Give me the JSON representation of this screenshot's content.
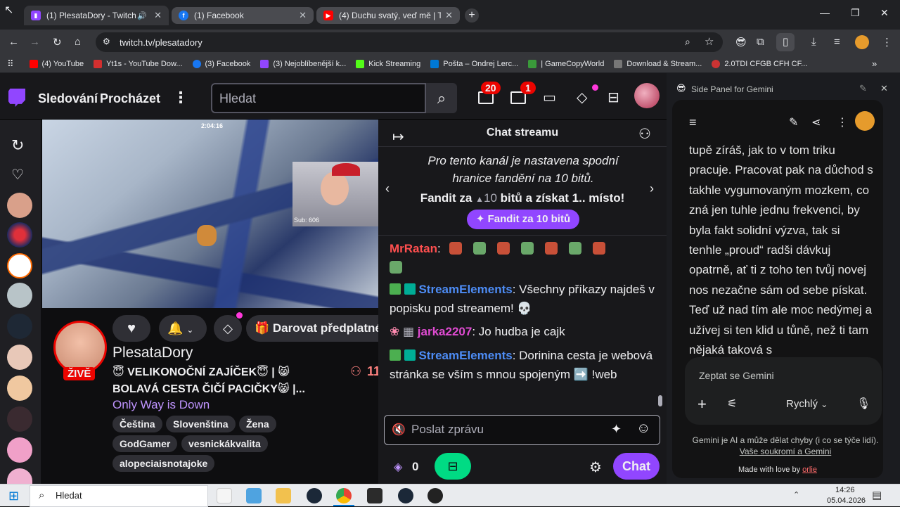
{
  "browser": {
    "tabs": [
      {
        "title": "(1) PlesataDory - Twitch",
        "active": true
      },
      {
        "title": "(1) Facebook",
        "active": false
      },
      {
        "title": "(4) Duchu svatý, veď mě | Temp",
        "active": false
      }
    ],
    "url": "twitch.tv/plesatadory",
    "bookmarks": [
      {
        "label": "(4) YouTube",
        "color": "#ff0000"
      },
      {
        "label": "Yt1s - YouTube Dow...",
        "color": "#d32f2f"
      },
      {
        "label": "(3) Facebook",
        "color": "#1877f2"
      },
      {
        "label": "(3) Nejoblíbenější k...",
        "color": "#9146ff"
      },
      {
        "label": "Kick Streaming",
        "color": "#53fc18"
      },
      {
        "label": "Pošta – Ondrej Lerc...",
        "color": "#0078d4"
      },
      {
        "label": "| GameCopyWorld",
        "color": "#3a9a3a"
      },
      {
        "label": "Download & Stream...",
        "color": "#777777"
      },
      {
        "label": "2.0TDI CFGB CFH CF...",
        "color": "#cc3333"
      }
    ]
  },
  "twitch": {
    "nav": {
      "following": "Sledování",
      "browse": "Procházet",
      "search_placeholder": "Hledat"
    },
    "badges": {
      "inbox": "20",
      "whispers": "1"
    },
    "stream": {
      "timer": "2:04:16",
      "viewer_overlay": "Sub: 606",
      "actions": {
        "gift": "Darovat předplatné"
      },
      "channel": "PlesataDory",
      "live_badge": "ŽIVĚ",
      "title": "😇 VELIKONOČNÍ ZAJÍČEK😇 | 😸 BOLAVÁ CESTA ČIČÍ PACIČKY😸 |...",
      "category": "Only Way is Down",
      "viewers": "11",
      "tags": [
        "Čeština",
        "Slovenština",
        "Žena",
        "GodGamer",
        "vesnickákvalita",
        "alopeciaisnotajoke"
      ]
    },
    "chat": {
      "header": "Chat streamu",
      "notice": "Pro tento kanál je nastavena spodní hranice fandění na 10 bitů.",
      "cheer_prefix": "Fandit za",
      "cheer_bits": "10",
      "cheer_suffix": "bitů a získat 1.. místo!",
      "cheer_button": "Fandit za 10 bitů",
      "messages": [
        {
          "user": "MrRatan",
          "color": "#ff4f4f",
          "text": ""
        },
        {
          "user": "StreamElements",
          "color": "#4d8cf5",
          "text": "Všechny příkazy najdeš v popisku pod streamem! 💀"
        },
        {
          "user": "jarka2207",
          "color": "#e04bd2",
          "text": "Jo hudba je cajk"
        },
        {
          "user": "StreamElements",
          "color": "#4d8cf5",
          "text": "Dorinina cesta je webová stránka se vším s mnou spojeným ➡️ !web"
        }
      ],
      "input_placeholder": "Poslat zprávu",
      "points": "0",
      "send_label": "Chat"
    }
  },
  "gemini": {
    "panel_title": "Side Panel for Gemini",
    "response": "tupě zíráš, jak to v tom triku pracuje. Pracovat pak na důchod s takhle vygumovaným mozkem, co zná jen tuhle jednu frekvenci, by byla fakt solidní výzva, tak si tenhle „proud“ radši dávkuj opatrně, ať ti z toho ten tvůj novej nos nezačne sám od sebe pískat. Teď už nad tím ale moc nedýmej a užívej si ten klid u tůně, než ti tam nějaká taková s",
    "input_placeholder": "Zeptat se Gemini",
    "mode": "Rychlý",
    "disclaimer": "Gemini je AI a může dělat chyby (i co se týče lidí).",
    "privacy_link": "Vaše soukromí a Gemini",
    "made_with": "Made with love by",
    "author": "orlie"
  },
  "taskbar": {
    "search": "Hledat",
    "time": "14:26",
    "date": "05.04.2026"
  }
}
